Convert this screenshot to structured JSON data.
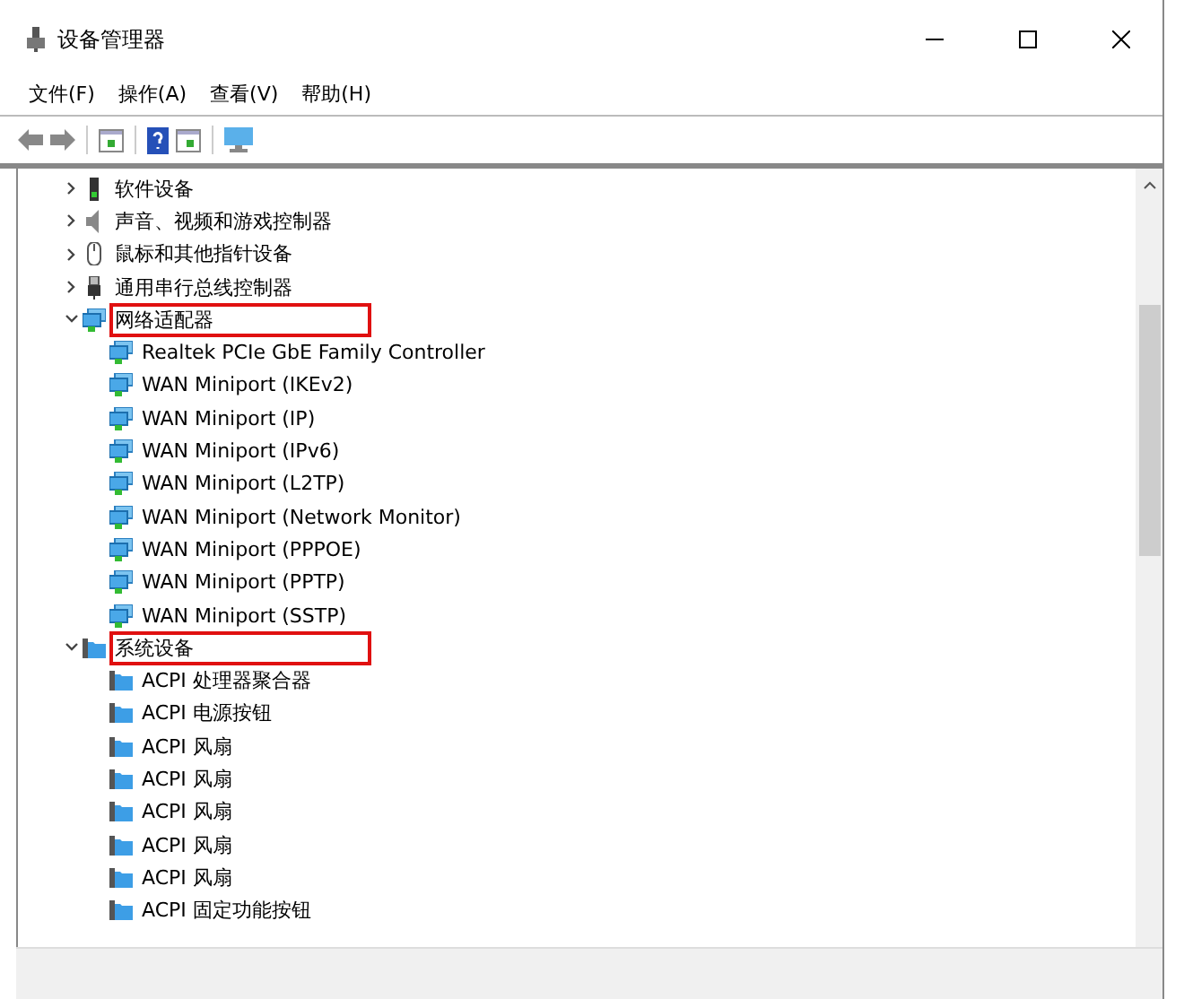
{
  "window": {
    "title": "设备管理器"
  },
  "menu": [
    "文件(F)",
    "操作(A)",
    "查看(V)",
    "帮助(H)"
  ],
  "tree": [
    {
      "label": "软件设备",
      "kind": "software",
      "expanded": false,
      "highlighted": false
    },
    {
      "label": "声音、视频和游戏控制器",
      "kind": "sound",
      "expanded": false,
      "highlighted": false
    },
    {
      "label": "鼠标和其他指针设备",
      "kind": "mouse",
      "expanded": false,
      "highlighted": false
    },
    {
      "label": "通用串行总线控制器",
      "kind": "usb",
      "expanded": false,
      "highlighted": false
    },
    {
      "label": "网络适配器",
      "kind": "network",
      "expanded": true,
      "highlighted": true,
      "children": [
        {
          "label": "Realtek PCIe GbE Family Controller",
          "kind": "network"
        },
        {
          "label": "WAN Miniport (IKEv2)",
          "kind": "network"
        },
        {
          "label": "WAN Miniport (IP)",
          "kind": "network"
        },
        {
          "label": "WAN Miniport (IPv6)",
          "kind": "network"
        },
        {
          "label": "WAN Miniport (L2TP)",
          "kind": "network"
        },
        {
          "label": "WAN Miniport (Network Monitor)",
          "kind": "network"
        },
        {
          "label": "WAN Miniport (PPPOE)",
          "kind": "network"
        },
        {
          "label": "WAN Miniport (PPTP)",
          "kind": "network"
        },
        {
          "label": "WAN Miniport (SSTP)",
          "kind": "network"
        }
      ]
    },
    {
      "label": "系统设备",
      "kind": "system",
      "expanded": true,
      "highlighted": true,
      "children": [
        {
          "label": "ACPI 处理器聚合器",
          "kind": "system"
        },
        {
          "label": "ACPI 电源按钮",
          "kind": "system"
        },
        {
          "label": "ACPI 风扇",
          "kind": "system"
        },
        {
          "label": "ACPI 风扇",
          "kind": "system"
        },
        {
          "label": "ACPI 风扇",
          "kind": "system"
        },
        {
          "label": "ACPI 风扇",
          "kind": "system"
        },
        {
          "label": "ACPI 风扇",
          "kind": "system"
        },
        {
          "label": "ACPI 固定功能按钮",
          "kind": "system"
        }
      ]
    }
  ]
}
